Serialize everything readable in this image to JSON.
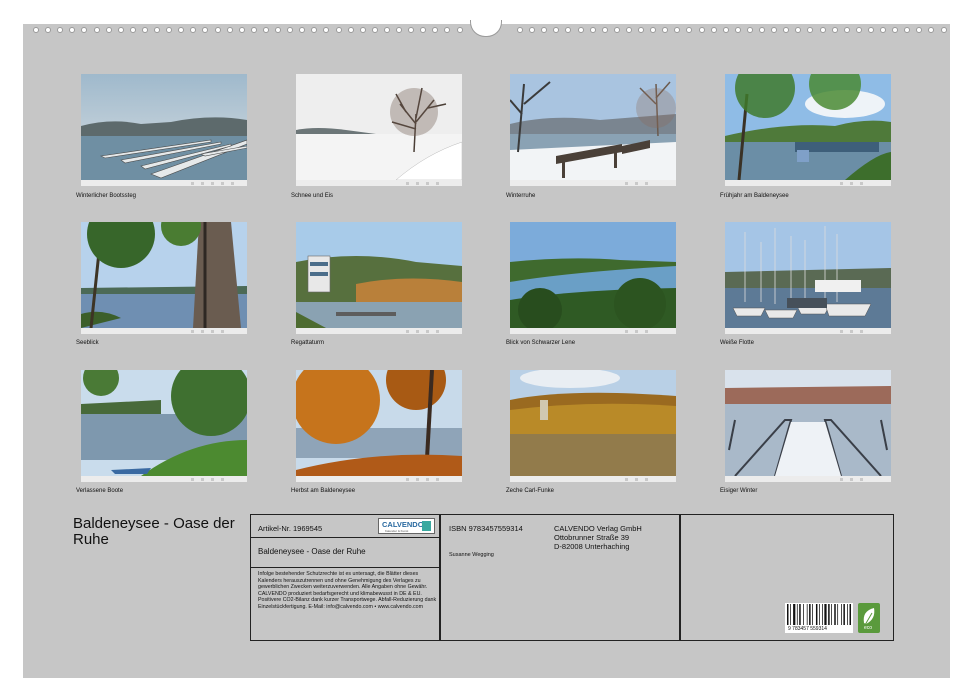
{
  "photos": [
    {
      "caption": "Winterlicher Bootssteg"
    },
    {
      "caption": "Schnee und Eis"
    },
    {
      "caption": "Winterruhe"
    },
    {
      "caption": "Frühjahr am Baldeneysee"
    },
    {
      "caption": "Seeblick"
    },
    {
      "caption": "Regattaturm"
    },
    {
      "caption": "Blick von Schwarzer Lene"
    },
    {
      "caption": "Weiße Flotte"
    },
    {
      "caption": "Verlassene Boote"
    },
    {
      "caption": "Herbst am Baldeneysee"
    },
    {
      "caption": "Zeche Carl-Funke"
    },
    {
      "caption": "Eisiger Winter"
    }
  ],
  "calendar_title": "Baldeneysee - Oase der Ruhe",
  "info": {
    "article_no": "Artikel-Nr. 1969545",
    "logo_text": "CALVENDO",
    "logo_tagline": "Kalender & Kunst",
    "product_title": "Baldeneysee - Oase der Ruhe",
    "legal_text": "Infolge bestehender Schutzrechte ist es untersagt, die Blätter dieses Kalenders herauszutrennen und ohne Genehmigung des Verlages zu gewerblichen Zwecken weiterzuverwenden. Alle Angaben ohne Gewähr. CALVENDO produziert bedarfsgerecht und klimabewusst in DE & EU. Positivere CO2-Bilanz dank kurzer Transportwege. Abfall-Reduzierung dank Einzelstückfertigung. E-Mail: info@calvendo.com • www.calvendo.com",
    "isbn": "ISBN 9783457559314",
    "author": "Susanne Wegging",
    "publisher_name": "CALVENDO Verlag GmbH",
    "publisher_street": "Ottobrunner Straße 39",
    "publisher_city": "D-82008 Unterhaching",
    "barcode_digits": "9 783457 559314",
    "eco_label": "eco"
  }
}
